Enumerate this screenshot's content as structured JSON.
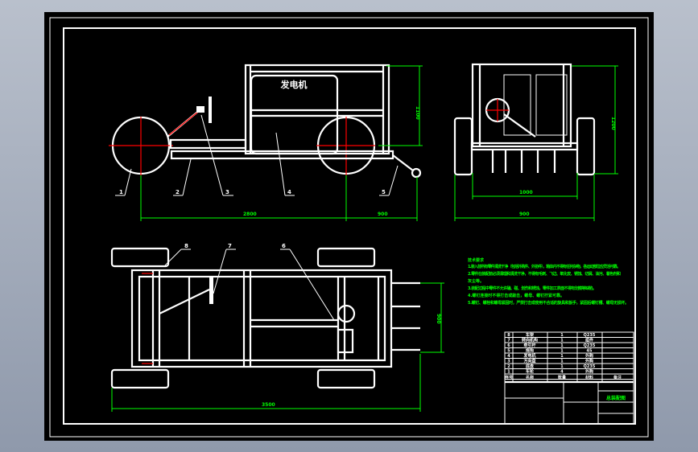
{
  "drawing": {
    "generator_label": "发电机",
    "side_view_part_numbers": [
      "1",
      "2",
      "3",
      "4",
      "5"
    ],
    "top_view_part_numbers": [
      "8",
      "7",
      "6"
    ],
    "dimensions": {
      "side_wheelbase": "2800",
      "side_tow": "900",
      "side_height": "1100",
      "rear_height": "1200",
      "rear_width": "1000",
      "top_length": "3500",
      "top_width": "900"
    }
  },
  "tech_requirements": {
    "title": "技术要求",
    "lines": [
      "1.装入前所有零件清洗干净（包括外购件、外协件），箱体内不得有任何杂物，各运动部位应灵活可靠。",
      "2.零件在装配前必须清理和清洗干净，不得有毛刺、飞边、氧化皮、锈蚀、切屑、油污、着色剂和",
      "灰尘等。",
      "3.装配过程中零件不允许磕、碰、划伤和锈蚀，零件加工表面不得有划痕等缺陷。",
      "4.螺钉连接时不得打击或敲击，螺母、螺钉拧紧可靠。",
      "5.螺钉、螺栓和螺母紧固时，严禁打击或使用不合适的旋具和扳手，紧固后螺钉槽、螺母无损坏。"
    ]
  },
  "title_block": {
    "headers": [
      "序号",
      "名称",
      "数量",
      "材料",
      "备注"
    ],
    "rows": [
      [
        "8",
        "车架",
        "1",
        "Q235",
        ""
      ],
      [
        "7",
        "转向机构",
        "1",
        "组件",
        ""
      ],
      [
        "6",
        "牵引杆",
        "1",
        "Q235",
        ""
      ],
      [
        "5",
        "拖钩",
        "1",
        "45",
        ""
      ],
      [
        "4",
        "发电机",
        "1",
        "外购",
        ""
      ],
      [
        "3",
        "方向盘",
        "1",
        "外购",
        ""
      ],
      [
        "2",
        "底盘",
        "1",
        "Q235",
        ""
      ],
      [
        "1",
        "车轮",
        "4",
        "外购",
        ""
      ]
    ],
    "drawing_name": "总装配图"
  }
}
